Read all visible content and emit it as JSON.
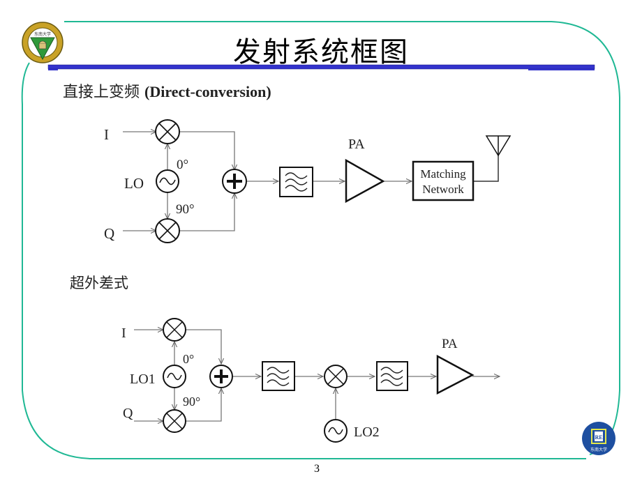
{
  "slide": {
    "title": "发射系统框图",
    "page_number": "3",
    "accent_color": "#1fb894",
    "title_bar_color": "#3333cc"
  },
  "logos": {
    "top_left": "Southeast University seal",
    "bottom_right": "东南大学"
  },
  "section1": {
    "heading_cn": "直接上变频 ",
    "heading_en": "(Direct-conversion)",
    "labels": {
      "i": "I",
      "q": "Q",
      "lo": "LO",
      "phase0": "0°",
      "phase90": "90°",
      "pa": "PA",
      "matching1": "Matching",
      "matching2": "Network"
    }
  },
  "section2": {
    "heading": "超外差式",
    "labels": {
      "i": "I",
      "q": "Q",
      "lo1": "LO1",
      "lo2": "LO2",
      "phase0": "0°",
      "phase90": "90°",
      "pa": "PA"
    }
  }
}
